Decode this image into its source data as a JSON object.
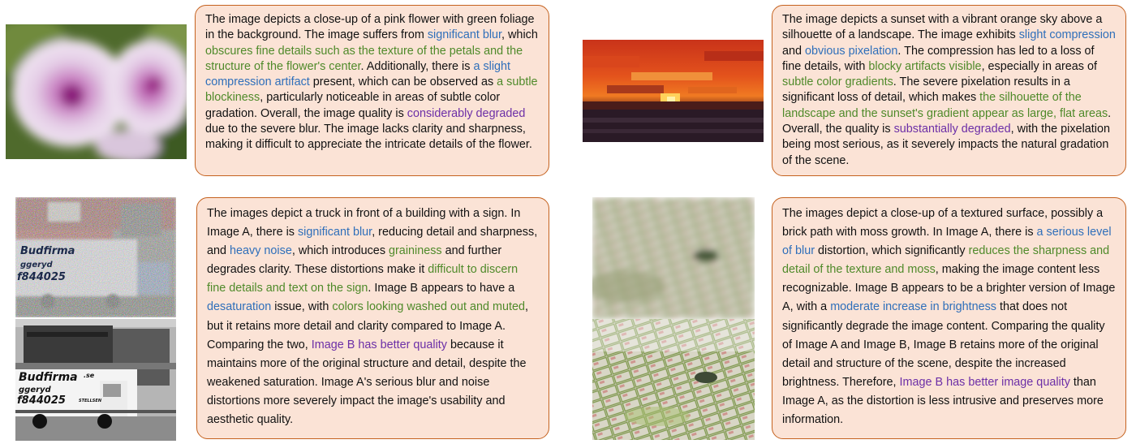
{
  "panels": [
    {
      "photo": "blurred-pink-flower",
      "segments": [
        {
          "t": "The image depicts a close-up of a pink flower with green foliage in the background. The image suffers from ",
          "c": "plain"
        },
        {
          "t": "significant blur",
          "c": "blue"
        },
        {
          "t": ", which ",
          "c": "plain"
        },
        {
          "t": "obscures fine details such as the texture of the petals and the structure of the flower's center",
          "c": "green"
        },
        {
          "t": ". Additionally, there is ",
          "c": "plain"
        },
        {
          "t": "a slight compression artifact",
          "c": "blue"
        },
        {
          "t": " present, which can be observed as ",
          "c": "plain"
        },
        {
          "t": "a subtle blockiness",
          "c": "green"
        },
        {
          "t": ", particularly noticeable in areas of subtle color gradation. Overall, the image quality is ",
          "c": "plain"
        },
        {
          "t": "considerably degraded",
          "c": "purple"
        },
        {
          "t": " due to the severe blur. The image lacks clarity and sharpness, making it difficult to appreciate the intricate details of the flower.",
          "c": "plain"
        }
      ]
    },
    {
      "photo": "pixelated-sunset",
      "segments": [
        {
          "t": "The image depicts a sunset with a vibrant orange sky above a silhouette of a landscape. The image exhibits ",
          "c": "plain"
        },
        {
          "t": "slight compression",
          "c": "blue"
        },
        {
          "t": " and ",
          "c": "plain"
        },
        {
          "t": "obvious pixelation",
          "c": "blue"
        },
        {
          "t": ". The compression has led to a loss of fine details, with ",
          "c": "plain"
        },
        {
          "t": "blocky artifacts visible",
          "c": "green"
        },
        {
          "t": ", especially in areas of ",
          "c": "plain"
        },
        {
          "t": "subtle color gradients",
          "c": "green"
        },
        {
          "t": ". The severe pixelation results in a significant loss of detail, which makes ",
          "c": "plain"
        },
        {
          "t": "the silhouette of the landscape and the sunset's gradient appear as large, flat areas",
          "c": "green"
        },
        {
          "t": ". Overall, the quality is ",
          "c": "plain"
        },
        {
          "t": "substantially degraded",
          "c": "purple"
        },
        {
          "t": ", with the pixelation being most serious, as it severely impacts the natural gradation of the scene.",
          "c": "plain"
        }
      ]
    },
    {
      "photo": "truck-pair",
      "truck_text": [
        "Budfirma",
        "ggeryd",
        "f844025"
      ],
      "truck_text_b": [
        ".se",
        "STELLSEN"
      ],
      "segments": [
        {
          "t": "The images depict a truck in front of a building with a sign. In Image A, there is ",
          "c": "plain"
        },
        {
          "t": "significant blur",
          "c": "blue"
        },
        {
          "t": ", reducing detail and sharpness, and ",
          "c": "plain"
        },
        {
          "t": "heavy noise",
          "c": "blue"
        },
        {
          "t": ", which introduces ",
          "c": "plain"
        },
        {
          "t": "graininess",
          "c": "green"
        },
        {
          "t": " and further degrades clarity. These distortions make it ",
          "c": "plain"
        },
        {
          "t": "difficult to discern fine details and text on the sign",
          "c": "green"
        },
        {
          "t": ". Image B appears to have a ",
          "c": "plain"
        },
        {
          "t": "desaturation",
          "c": "blue"
        },
        {
          "t": " issue, with ",
          "c": "plain"
        },
        {
          "t": "colors looking washed out and muted",
          "c": "green"
        },
        {
          "t": ", but it retains more detail and clarity compared to Image A. Comparing the two, ",
          "c": "plain"
        },
        {
          "t": "Image B has better quality",
          "c": "purple"
        },
        {
          "t": " because it maintains more of the original structure and detail, despite the weakened saturation. Image A's serious blur and noise distortions more severely impact the image's usability and aesthetic quality.",
          "c": "plain"
        }
      ]
    },
    {
      "photo": "brick-path-pair",
      "segments": [
        {
          "t": "The images depict a close-up of a textured surface, possibly a brick path with moss growth. In Image A, there is ",
          "c": "plain"
        },
        {
          "t": "a serious level of blur",
          "c": "blue"
        },
        {
          "t": " distortion, which significantly ",
          "c": "plain"
        },
        {
          "t": "reduces the sharpness and detail of the texture and moss",
          "c": "green"
        },
        {
          "t": ", making the image content less recognizable. Image B appears to be a brighter version of Image A, with a ",
          "c": "plain"
        },
        {
          "t": "moderate increase in brightness",
          "c": "blue"
        },
        {
          "t": " that does not significantly degrade the image content. Comparing the quality of Image A and Image B, Image B retains more of the original detail and structure of the scene, despite the increased brightness. Therefore, ",
          "c": "plain"
        },
        {
          "t": "Image B has better image quality",
          "c": "purple"
        },
        {
          "t": " than Image A, as the distortion is less intrusive and preserves more information.",
          "c": "plain"
        }
      ]
    }
  ],
  "colors": {
    "blue": "#2f6fba",
    "green": "#4f8a2a",
    "purple": "#6c2fa7",
    "box_fill": "#fbe3d6",
    "box_border": "#c5621f"
  }
}
